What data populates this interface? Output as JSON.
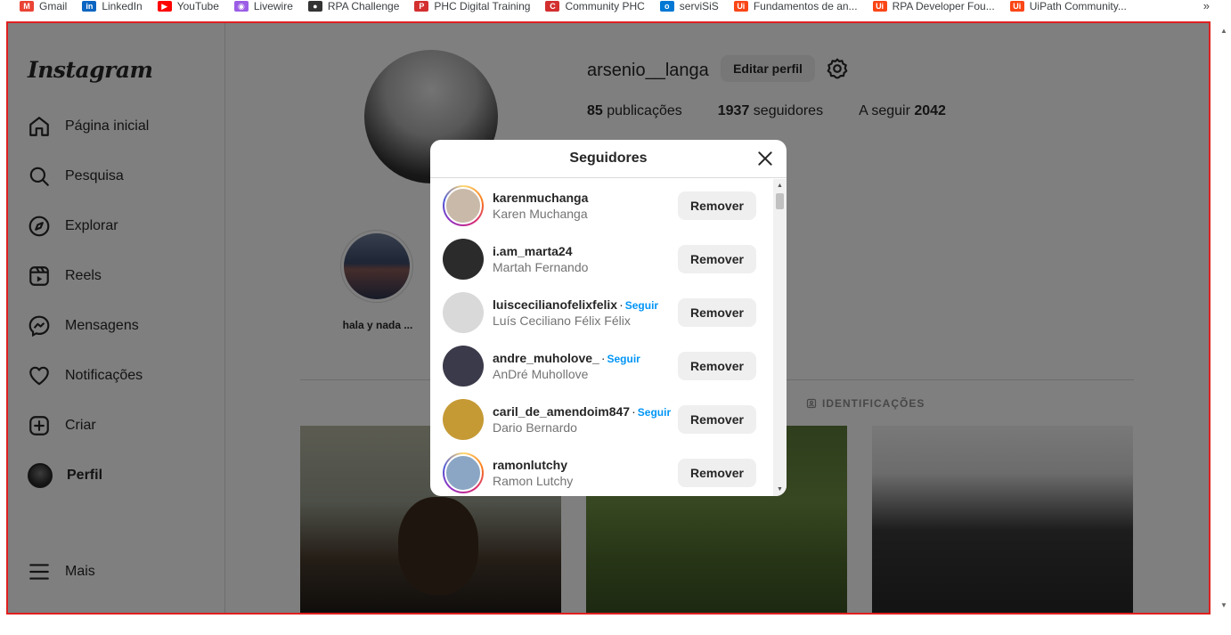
{
  "bookmarks": [
    {
      "label": "Gmail",
      "icon": "M",
      "color": "#ea4335"
    },
    {
      "label": "LinkedIn",
      "icon": "in",
      "color": "#0a66c2"
    },
    {
      "label": "YouTube",
      "icon": "▶",
      "color": "#ff0000"
    },
    {
      "label": "Livewire",
      "icon": "◉",
      "color": "#9b5de5"
    },
    {
      "label": "RPA Challenge",
      "icon": "●",
      "color": "#333333"
    },
    {
      "label": "PHC Digital Training",
      "icon": "P",
      "color": "#d32f2f"
    },
    {
      "label": "Community PHC",
      "icon": "C",
      "color": "#d32f2f"
    },
    {
      "label": "serviSiS",
      "icon": "o",
      "color": "#0078d4"
    },
    {
      "label": "Fundamentos de an...",
      "icon": "Ui",
      "color": "#fa4616"
    },
    {
      "label": "RPA Developer Fou...",
      "icon": "Ui",
      "color": "#fa4616"
    },
    {
      "label": "UiPath Community...",
      "icon": "Ui",
      "color": "#fa4616"
    }
  ],
  "bookmarks_more": "»",
  "sidebar": {
    "logo": "Instagram",
    "items": [
      {
        "label": "Página inicial",
        "icon": "home-icon"
      },
      {
        "label": "Pesquisa",
        "icon": "search-icon"
      },
      {
        "label": "Explorar",
        "icon": "compass-icon"
      },
      {
        "label": "Reels",
        "icon": "reels-icon"
      },
      {
        "label": "Mensagens",
        "icon": "messenger-icon"
      },
      {
        "label": "Notificações",
        "icon": "heart-icon"
      },
      {
        "label": "Criar",
        "icon": "plus-square-icon"
      },
      {
        "label": "Perfil",
        "icon": "avatar"
      }
    ],
    "more": "Mais"
  },
  "profile": {
    "username": "arsenio__langa",
    "edit_label": "Editar perfil",
    "posts_count": "85",
    "posts_label": "publicações",
    "followers_count": "1937",
    "followers_label": "seguidores",
    "following_label": "A seguir",
    "following_count": "2042",
    "highlight_label": "hala y nada ...",
    "tagged_tab": "IDENTIFICAÇÕES"
  },
  "modal": {
    "title": "Seguidores",
    "remove_label": "Remover",
    "follow_label": "Seguir",
    "followers": [
      {
        "username": "karenmuchanga",
        "name": "Karen Muchanga",
        "follow": false,
        "ring": true,
        "avatar_color": "#c9b9a8"
      },
      {
        "username": "i.am_marta24",
        "name": "Martah Fernando",
        "follow": false,
        "ring": false,
        "avatar_color": "#2b2b2b"
      },
      {
        "username": "luiscecilianofelixfelix",
        "name": "Luís Ceciliano Félix Félix",
        "follow": true,
        "ring": false,
        "avatar_color": "#d9d9d9"
      },
      {
        "username": "andre_muholove_",
        "name": "AnDré Muhollove",
        "follow": true,
        "ring": false,
        "avatar_color": "#3a3a4a"
      },
      {
        "username": "caril_de_amendoim847",
        "name": "Dario Bernardo",
        "follow": true,
        "ring": false,
        "avatar_color": "#c59a35"
      },
      {
        "username": "ramonlutchy",
        "name": "Ramon Lutchy",
        "follow": false,
        "ring": true,
        "avatar_color": "#8aa6c4"
      }
    ]
  }
}
